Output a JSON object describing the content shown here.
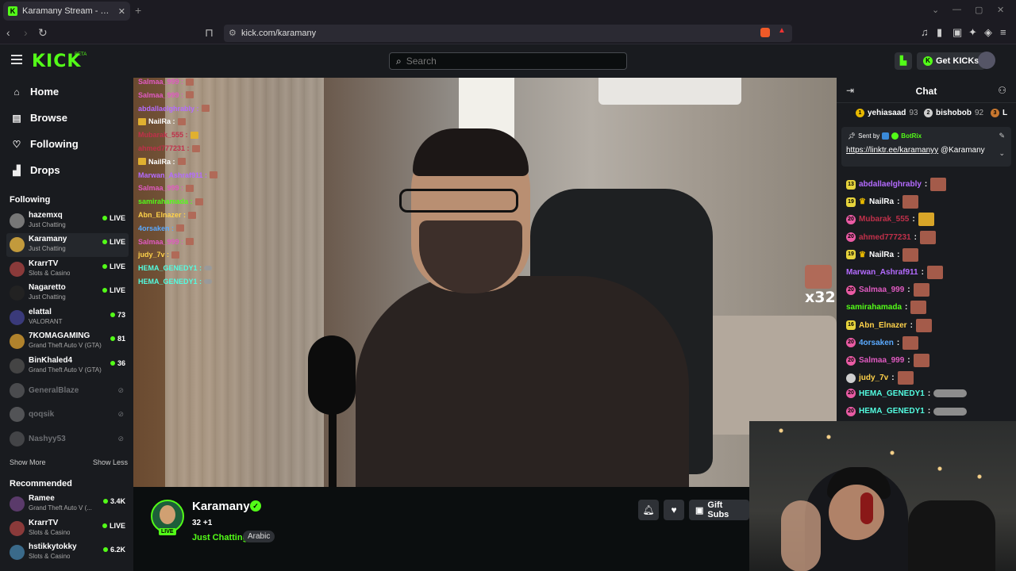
{
  "browser": {
    "tab_title": "Karamany Stream - Watch Live o",
    "url": "kick.com/karamany"
  },
  "header": {
    "logo": "KICK",
    "logo_beta": "BETA",
    "search_placeholder": "Search",
    "get_kicks": "Get KICKs"
  },
  "sidebar": {
    "nav": [
      {
        "label": "Home",
        "icon": "home-icon"
      },
      {
        "label": "Browse",
        "icon": "browse-icon"
      },
      {
        "label": "Following",
        "icon": "heart-icon"
      },
      {
        "label": "Drops",
        "icon": "drops-icon"
      }
    ],
    "following_title": "Following",
    "following": [
      {
        "name": "hazemxq",
        "category": "Just Chatting",
        "status": "LIVE"
      },
      {
        "name": "Karamany",
        "category": "Just Chatting",
        "status": "LIVE"
      },
      {
        "name": "KrarrTV",
        "category": "Slots & Casino",
        "status": "LIVE"
      },
      {
        "name": "Nagaretto",
        "category": "Just Chatting",
        "status": "LIVE"
      },
      {
        "name": "elattal",
        "category": "VALORANT",
        "status": "73"
      },
      {
        "name": "7KOMAGAMING",
        "category": "Grand Theft Auto V (GTA)",
        "status": "81"
      },
      {
        "name": "BinKhaled4",
        "category": "Grand Theft Auto V (GTA)",
        "status": "36"
      }
    ],
    "offline": [
      "GeneralBlaze",
      "qoqsik",
      "Nashyy53"
    ],
    "show_more": "Show More",
    "show_less": "Show Less",
    "recommended_title": "Recommended",
    "recommended": [
      {
        "name": "Ramee",
        "category": "Grand Theft Auto V (...",
        "status": "3.4K"
      },
      {
        "name": "KrarrTV",
        "category": "Slots & Casino",
        "status": "LIVE"
      },
      {
        "name": "hstikkytokky",
        "category": "Slots & Casino",
        "status": "6.2K"
      }
    ]
  },
  "video_overlay_chat": [
    {
      "user": "Salmaa_999 :",
      "color": "#e05ac1"
    },
    {
      "user": "Salmaa_999 :",
      "color": "#e05ac1"
    },
    {
      "user": "abdallaelghrably :",
      "color": "#b46bff"
    },
    {
      "user": "NailRa :",
      "color": "#ffffff"
    },
    {
      "user": "Mubarak_555 :",
      "color": "#c0304a"
    },
    {
      "user": "ahmed777231 :",
      "color": "#c0304a"
    },
    {
      "user": "NailRa :",
      "color": "#ffffff"
    },
    {
      "user": "Marwan_Ashraf911 :",
      "color": "#b46bff"
    },
    {
      "user": "Salmaa_999 :",
      "color": "#e05ac1"
    },
    {
      "user": "samirahamada :",
      "color": "#53fc18"
    },
    {
      "user": "Abn_Elnazer :",
      "color": "#ffd24a"
    },
    {
      "user": "4orsaken :",
      "color": "#5aa9ff"
    },
    {
      "user": "Salmaa_999 :",
      "color": "#e05ac1"
    },
    {
      "user": "judy_7v :",
      "color": "#ffd24a"
    },
    {
      "user": "HEMA_GENEDY1 :",
      "color": "#53fce0"
    },
    {
      "user": "HEMA_GENEDY1 :",
      "color": "#53fce0"
    }
  ],
  "video_badge": "x32",
  "streamer": {
    "name": "Karamany",
    "viewers": "32 +1",
    "category": "Just Chatting",
    "tag": "Arabic",
    "live": "LIVE",
    "gift_subs": "Gift Subs"
  },
  "chat": {
    "title": "Chat",
    "leaderboard": [
      {
        "rank": "1",
        "name": "yehiasaad",
        "points": "93"
      },
      {
        "rank": "2",
        "name": "bishobob",
        "points": "92"
      },
      {
        "rank": "3",
        "name": "L",
        "points": ""
      }
    ],
    "pinned": {
      "sent_by_label": "Sent by",
      "sender": "BotRix",
      "link": "https://linktr.ee/karamanyy",
      "mention": "@Karamany"
    },
    "messages": [
      {
        "badge": "13",
        "user": "abdallaelghrably",
        "color": "#b46bff",
        "badge_type": "sub",
        "emote": "red"
      },
      {
        "badge": "19",
        "user": "NailRa",
        "color": "#ffffff",
        "badge_type": "sub-crown",
        "emote": "red"
      },
      {
        "badge": "20",
        "user": "Mubarak_555",
        "color": "#c0304a",
        "badge_type": "pink",
        "emote": "yellow"
      },
      {
        "badge": "20",
        "user": "ahmed777231",
        "color": "#c0304a",
        "badge_type": "pink",
        "emote": "red"
      },
      {
        "badge": "19",
        "user": "NailRa",
        "color": "#ffffff",
        "badge_type": "sub-crown",
        "emote": "red"
      },
      {
        "badge": "",
        "user": "Marwan_Ashraf911",
        "color": "#b46bff",
        "badge_type": "none",
        "emote": "red"
      },
      {
        "badge": "20",
        "user": "Salmaa_999",
        "color": "#e05ac1",
        "badge_type": "pink",
        "emote": "red"
      },
      {
        "badge": "",
        "user": "samirahamada",
        "color": "#53fc18",
        "badge_type": "none",
        "emote": "red"
      },
      {
        "badge": "16",
        "user": "Abn_Elnazer",
        "color": "#ffd24a",
        "badge_type": "sub",
        "emote": "red"
      },
      {
        "badge": "20",
        "user": "4orsaken",
        "color": "#5aa9ff",
        "badge_type": "pink",
        "emote": "red"
      },
      {
        "badge": "20",
        "user": "Salmaa_999",
        "color": "#e05ac1",
        "badge_type": "pink",
        "emote": "red"
      },
      {
        "badge": "",
        "user": "judy_7v",
        "color": "#ffd24a",
        "badge_type": "grey",
        "emote": "red"
      },
      {
        "badge": "20",
        "user": "HEMA_GENEDY1",
        "color": "#53fce0",
        "badge_type": "pink",
        "emote": "wide"
      },
      {
        "badge": "20",
        "user": "HEMA_GENEDY1",
        "color": "#53fce0",
        "badge_type": "pink",
        "emote": "wide"
      }
    ]
  }
}
